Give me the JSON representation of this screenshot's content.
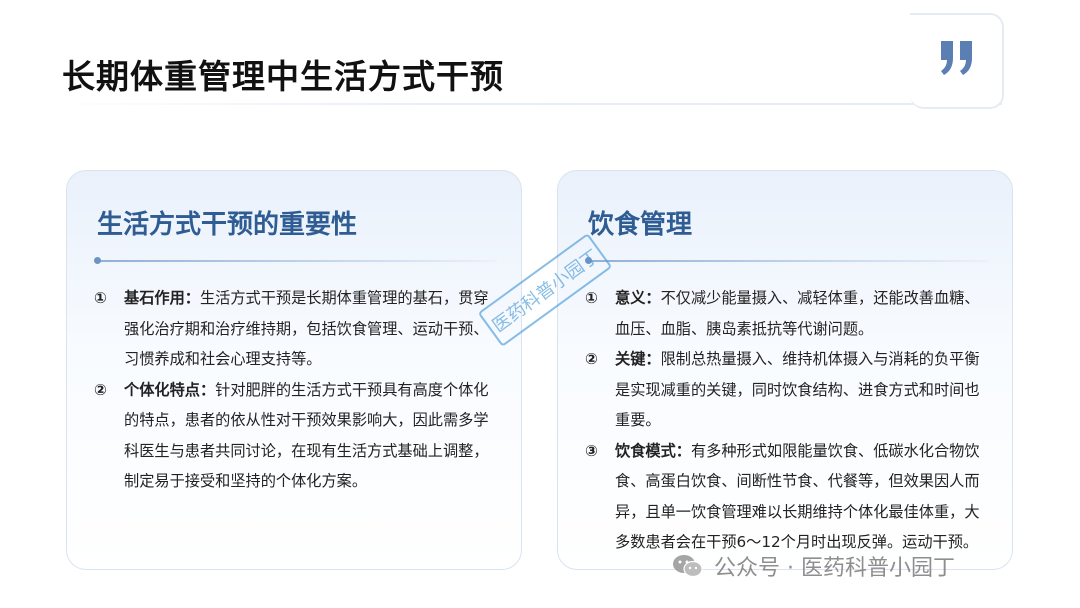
{
  "page": {
    "title": "长期体重管理中生活方式干预"
  },
  "left_card": {
    "title": "生活方式干预的重要性",
    "items": [
      {
        "num": "①",
        "key": "基石作用：",
        "text": "生活方式干预是长期体重管理的基石，贯穿强化治疗期和治疗维持期，包括饮食管理、运动干预、习惯养成和社会心理支持等。"
      },
      {
        "num": "②",
        "key": "个体化特点：",
        "text": "针对肥胖的生活方式干预具有高度个体化的特点，患者的依从性对干预效果影响大，因此需多学科医生与患者共同讨论，在现有生活方式基础上调整，制定易于接受和坚持的个体化方案。"
      }
    ]
  },
  "right_card": {
    "title": "饮食管理",
    "items": [
      {
        "num": "①",
        "key": "意义：",
        "text": "不仅减少能量摄入、减轻体重，还能改善血糖、血压、血脂、胰岛素抵抗等代谢问题。"
      },
      {
        "num": "②",
        "key": "关键：",
        "text": "限制总热量摄入、维持机体摄入与消耗的负平衡是实现减重的关键，同时饮食结构、进食方式和时间也重要。"
      },
      {
        "num": "③",
        "key": "饮食模式：",
        "text": "有多种形式如限能量饮食、低碳水化合物饮食、高蛋白饮食、间断性节食、代餐等，但效果因人而异，且单一饮食管理难以长期维持个体化最佳体重，大多数患者会在干预6～12个月时出现反弹。运动干预。"
      }
    ]
  },
  "watermark": {
    "stamp_text": "医药科普小园丁"
  },
  "footer": {
    "text": "公众号 · 医药科普小园丁",
    "icon": "wechat-icon"
  },
  "colors": {
    "accent": "#2e5c93",
    "line": "#8fb0d8",
    "quote": "#5b7fb3",
    "footer_text": "#8e8e8e"
  }
}
